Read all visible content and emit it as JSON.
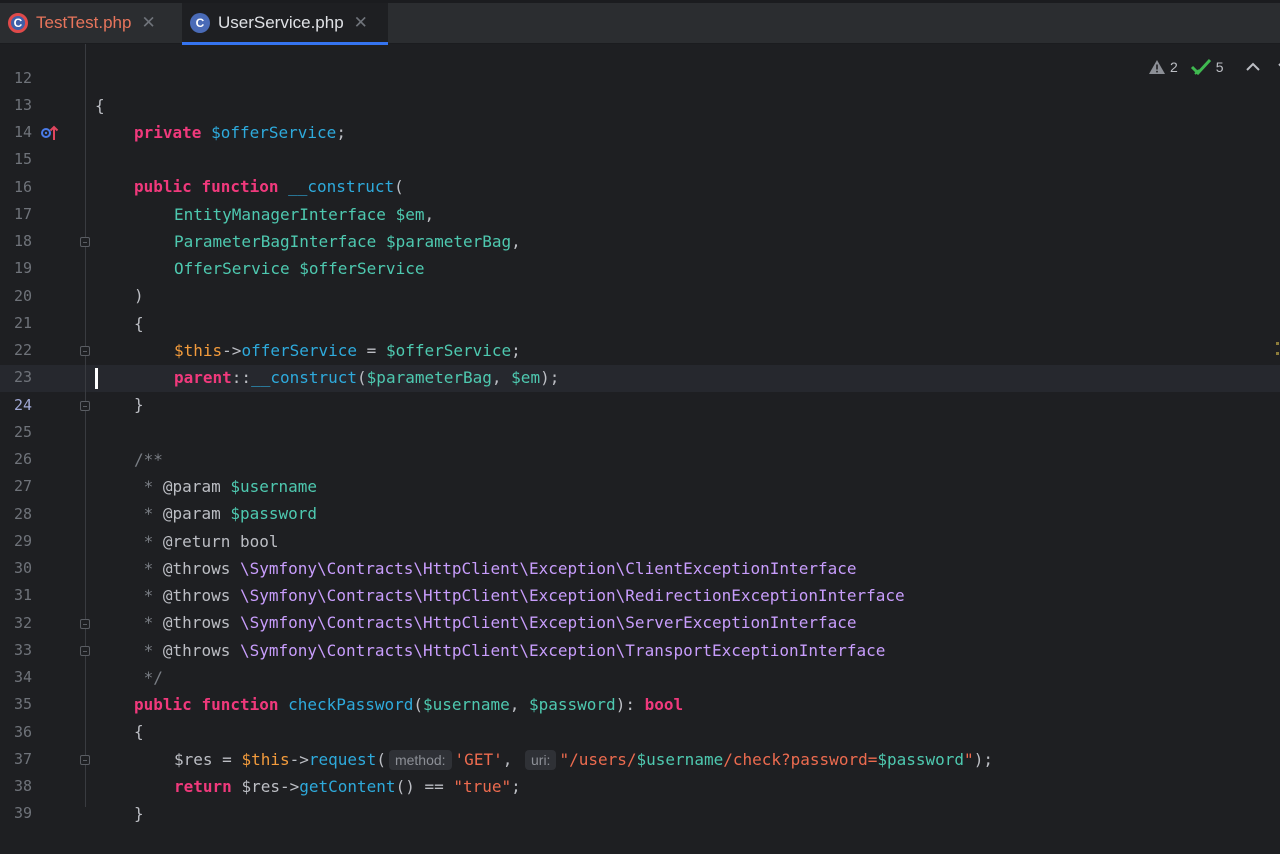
{
  "tabs": [
    {
      "label": "TestTest.php",
      "icon": "php-class-icon",
      "close": "✕",
      "active": false
    },
    {
      "label": "UserService.php",
      "icon": "php-class-icon",
      "close": "✕",
      "active": true
    }
  ],
  "inspections": {
    "warnings": "2",
    "ok": "5"
  },
  "colors": {
    "accent": "#3574f0",
    "background": "#1e1f22",
    "keyword": "#f0397c"
  },
  "hints": {
    "method": "method:",
    "uri": "uri:"
  },
  "line_numbers": [
    "12",
    "13",
    "14",
    "15",
    "16",
    "17",
    "18",
    "19",
    "20",
    "21",
    "22",
    "23",
    "24",
    "25",
    "26",
    "27",
    "28",
    "29",
    "30",
    "31",
    "32",
    "33",
    "34",
    "35",
    "36",
    "37",
    "38",
    "39"
  ],
  "code": {
    "l12_brace": "{",
    "l13_private": "private",
    "l13_var": "$offerService",
    "semi": ";",
    "public": "public",
    "function": "function",
    "l15_name": "__construct",
    "l16_type": "EntityManagerInterface",
    "l16_var": "$em",
    "l17_type": "ParameterBagInterface",
    "l17_var": "$parameterBag",
    "l18_type": "OfferService",
    "l18_var": "$offerService",
    "l19": ")",
    "l20": "{",
    "this": "$this",
    "arrow": "->",
    "l21_prop": "offerService",
    "l21_assign": " = ",
    "l21_var": "$offerService",
    "l22_parent": "parent",
    "l22_sep": "::",
    "l22_fn": "__construct",
    "l22_args_open": "(",
    "l22_arg1": "$parameterBag",
    "l22_comma": ", ",
    "l22_arg2": "$em",
    "l22_close": ");",
    "l23": "}",
    "l25": "/**",
    "star": " * ",
    "param_tag": "@param",
    "l26_var": "$username",
    "l27_var": "$password",
    "return_tag": "@return",
    "l28_type": "bool",
    "throws_tag": "@throws",
    "l29_ns": "\\Symfony\\Contracts\\HttpClient\\Exception\\ClientExceptionInterface",
    "l30_ns": "\\Symfony\\Contracts\\HttpClient\\Exception\\RedirectionExceptionInterface",
    "l31_ns": "\\Symfony\\Contracts\\HttpClient\\Exception\\ServerExceptionInterface",
    "l32_ns": "\\Symfony\\Contracts\\HttpClient\\Exception\\TransportExceptionInterface",
    "l33": " */",
    "l34_name": "checkPassword",
    "l34_open": "(",
    "l34_arg1": "$username",
    "l34_comma": ", ",
    "l34_arg2": "$password",
    "l34_close": "): ",
    "l34_ret": "bool",
    "l35": "{",
    "l36_res": "$res",
    "l36_assign": " = ",
    "l36_fn": "request",
    "l36_open": "(",
    "l36_str1": "'GET'",
    "l36_comma": ",",
    "l36_q1": "\"/users/",
    "l36_v1": "$username",
    "l36_q2": "/check?password=",
    "l36_v2": "$password",
    "l36_q3": "\"",
    "l36_close": ");",
    "l37_return": "return",
    "l37_res": "$res",
    "l37_fn": "getContent",
    "l37_rest": "() == ",
    "l37_str": "\"true\"",
    "l38": "}"
  }
}
